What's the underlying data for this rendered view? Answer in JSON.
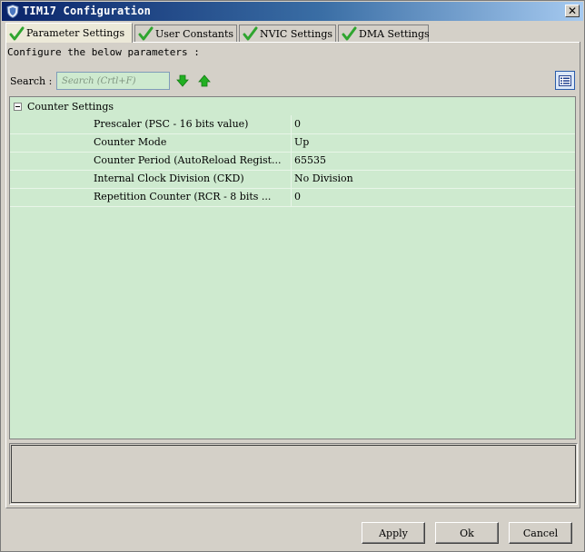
{
  "window": {
    "title": "TIM17 Configuration",
    "close_symbol": "✕"
  },
  "tabs": [
    {
      "label": "Parameter Settings",
      "active": true,
      "icon": "check-icon"
    },
    {
      "label": "User Constants",
      "active": false,
      "icon": "check-icon"
    },
    {
      "label": "NVIC Settings",
      "active": false,
      "icon": "check-icon"
    },
    {
      "label": "DMA Settings",
      "active": false,
      "icon": "check-icon"
    }
  ],
  "instruction": "Configure the below parameters :",
  "search": {
    "label": "Search :",
    "placeholder": "Search (Crtl+F)"
  },
  "group": {
    "label": "Counter Settings",
    "expanded": true
  },
  "parameters": [
    {
      "name": "Prescaler (PSC - 16 bits value)",
      "value": "0"
    },
    {
      "name": "Counter Mode",
      "value": "Up"
    },
    {
      "name": "Counter Period (AutoReload Regist...",
      "value": "65535"
    },
    {
      "name": "Internal Clock Division (CKD)",
      "value": "No Division"
    },
    {
      "name": "Repetition Counter (RCR - 8 bits ...",
      "value": "0"
    }
  ],
  "footer": {
    "apply_label": "Apply",
    "ok_label": "Ok",
    "cancel_label": "Cancel"
  },
  "colors": {
    "grid_background": "#ceeacf",
    "check_green": "#2fa52f",
    "arrow_green": "#22b022",
    "titlebar_start": "#0a246a"
  }
}
